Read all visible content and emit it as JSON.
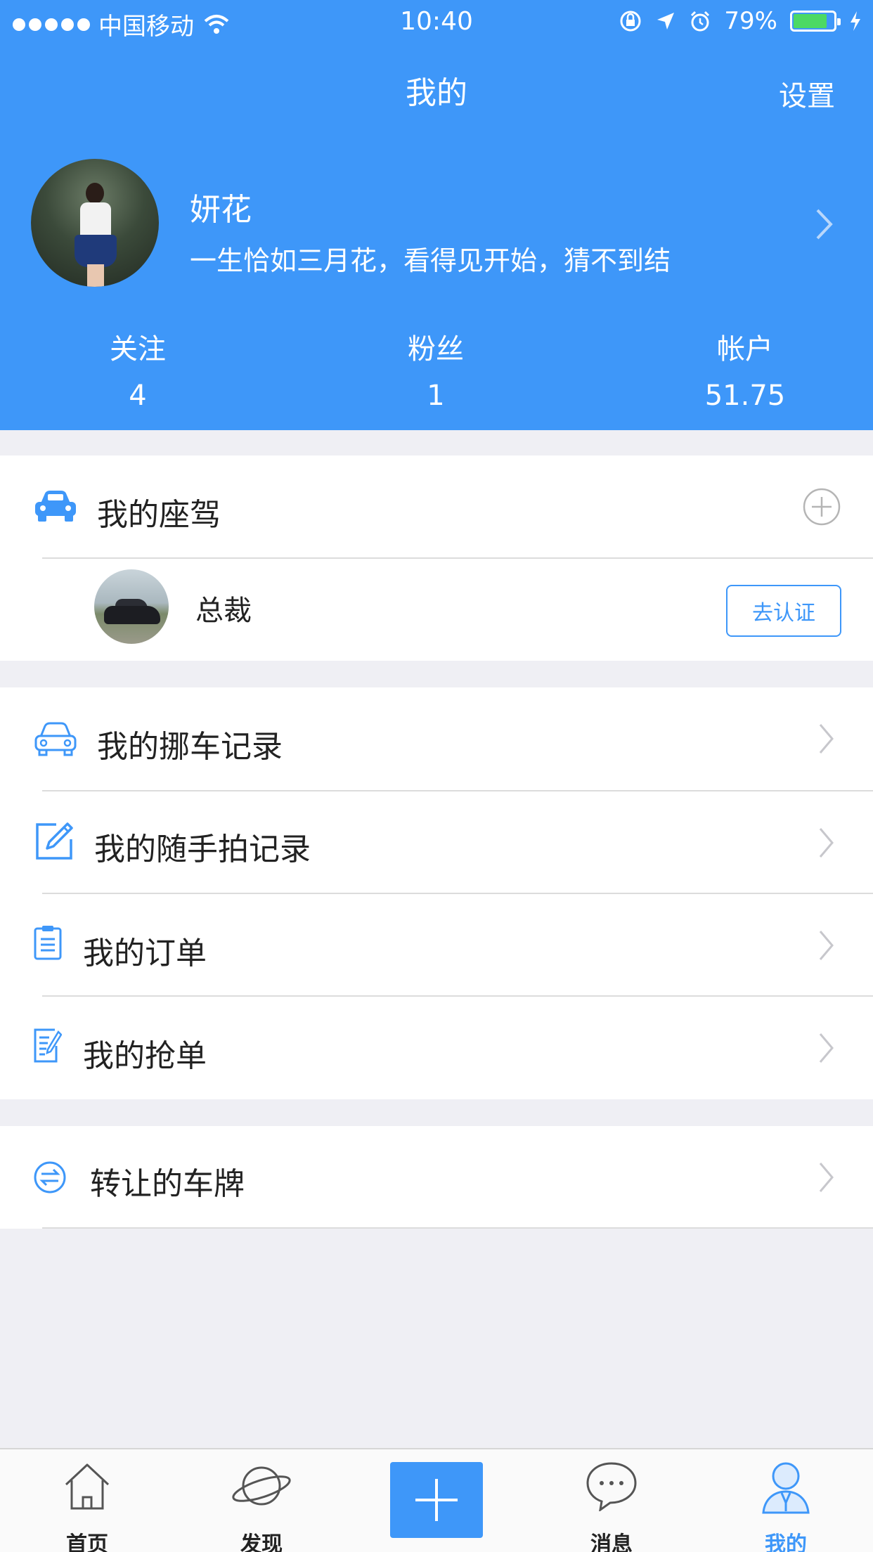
{
  "status_bar": {
    "carrier": "中国移动",
    "time": "10:40",
    "battery": "79%",
    "battery_level": 0.79
  },
  "nav": {
    "title": "我的",
    "settings_label": "设置"
  },
  "profile": {
    "name": "妍花",
    "bio": "一生恰如三月花，看得见开始，猜不到结"
  },
  "stats": [
    {
      "label": "关注",
      "value": "4"
    },
    {
      "label": "粉丝",
      "value": "1"
    },
    {
      "label": "帐户",
      "value": "51.75"
    }
  ],
  "my_cars": {
    "title": "我的座驾",
    "car_name": "总裁",
    "verify_label": "去认证"
  },
  "menu": [
    {
      "label": "我的挪车记录",
      "icon": "car-outline-icon"
    },
    {
      "label": "我的随手拍记录",
      "icon": "edit-icon"
    },
    {
      "label": "我的订单",
      "icon": "clipboard-icon"
    },
    {
      "label": "我的抢单",
      "icon": "list-edit-icon"
    }
  ],
  "transfer": {
    "label": "转让的车牌",
    "icon": "exchange-icon"
  },
  "tabbar": {
    "items": [
      {
        "label": "首页",
        "icon": "home-icon"
      },
      {
        "label": "发现",
        "icon": "planet-icon"
      },
      {
        "label": "",
        "icon": "plus-icon"
      },
      {
        "label": "消息",
        "icon": "chat-bubble-icon"
      },
      {
        "label": "我的",
        "icon": "user-icon"
      }
    ],
    "active_index": 4
  },
  "colors": {
    "accent": "#3e97f9",
    "background": "#efeff4",
    "battery_green": "#4cd964"
  }
}
